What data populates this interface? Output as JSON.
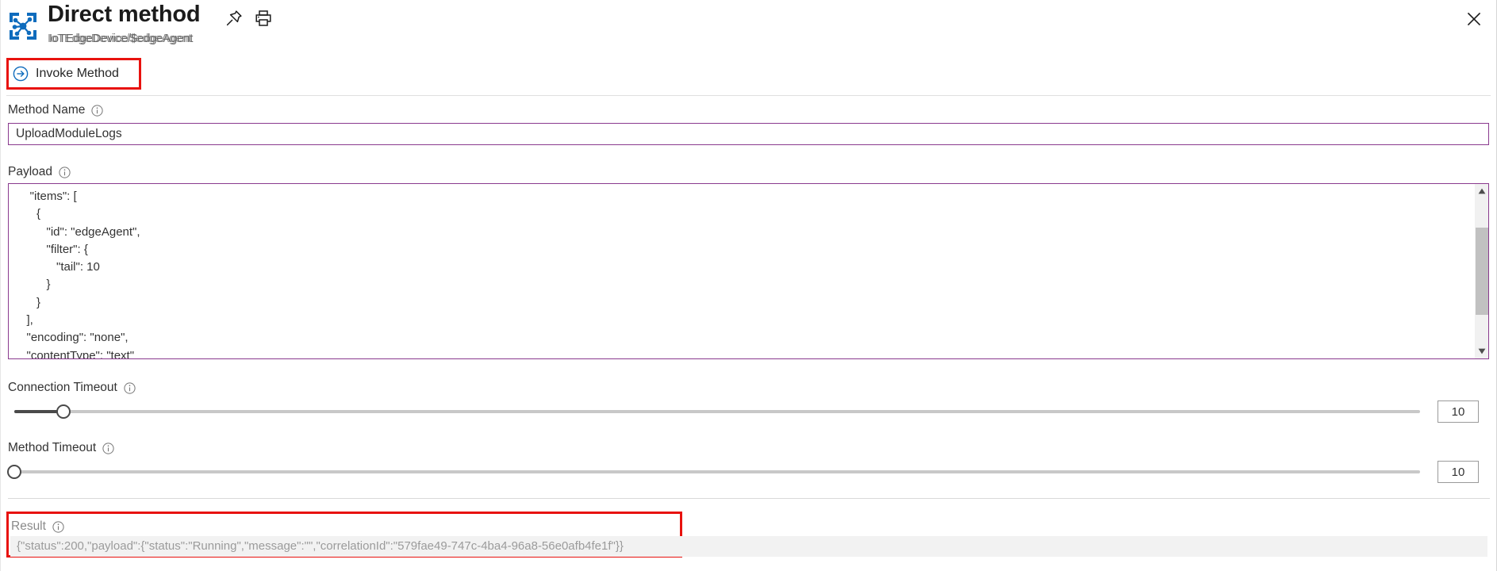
{
  "header": {
    "icon_name": "iot-hub-icon",
    "title": "Direct method",
    "subtitle": "IoTEdgeDevice/$edgeAgent",
    "pin_icon": "pin-icon",
    "print_icon": "print-icon",
    "close_icon": "close-icon"
  },
  "command_bar": {
    "invoke_label": "Invoke Method",
    "invoke_icon": "arrow-right-circle-icon",
    "highlight_color": "#e8120e"
  },
  "form": {
    "method_name": {
      "label": "Method Name",
      "value": "UploadModuleLogs",
      "placeholder": "Method Name"
    },
    "payload": {
      "label": "Payload",
      "value": "    \"items\": [\n      {\n         \"id\": \"edgeAgent\",\n         \"filter\": {\n            \"tail\": 10\n         }\n      }\n   ],\n   \"encoding\": \"none\",\n   \"contentType\": \"text\"",
      "scroll_up_icon": "chevron-up-icon",
      "scroll_down_icon": "chevron-down-icon"
    },
    "connection_timeout": {
      "label": "Connection Timeout",
      "value": "10",
      "percent": 3.5
    },
    "method_timeout": {
      "label": "Method Timeout",
      "value": "10",
      "percent": 0
    }
  },
  "result": {
    "label": "Result",
    "value": "{\"status\":200,\"payload\":{\"status\":\"Running\",\"message\":\"\",\"correlationId\":\"579fae49-747c-4ba4-96a8-56e0afb4fe1f\"}}",
    "highlight_color": "#e8120e"
  },
  "colors": {
    "accent_border": "#8a3a8e",
    "azure_blue": "#0078d4",
    "highlight_red": "#e8120e"
  }
}
